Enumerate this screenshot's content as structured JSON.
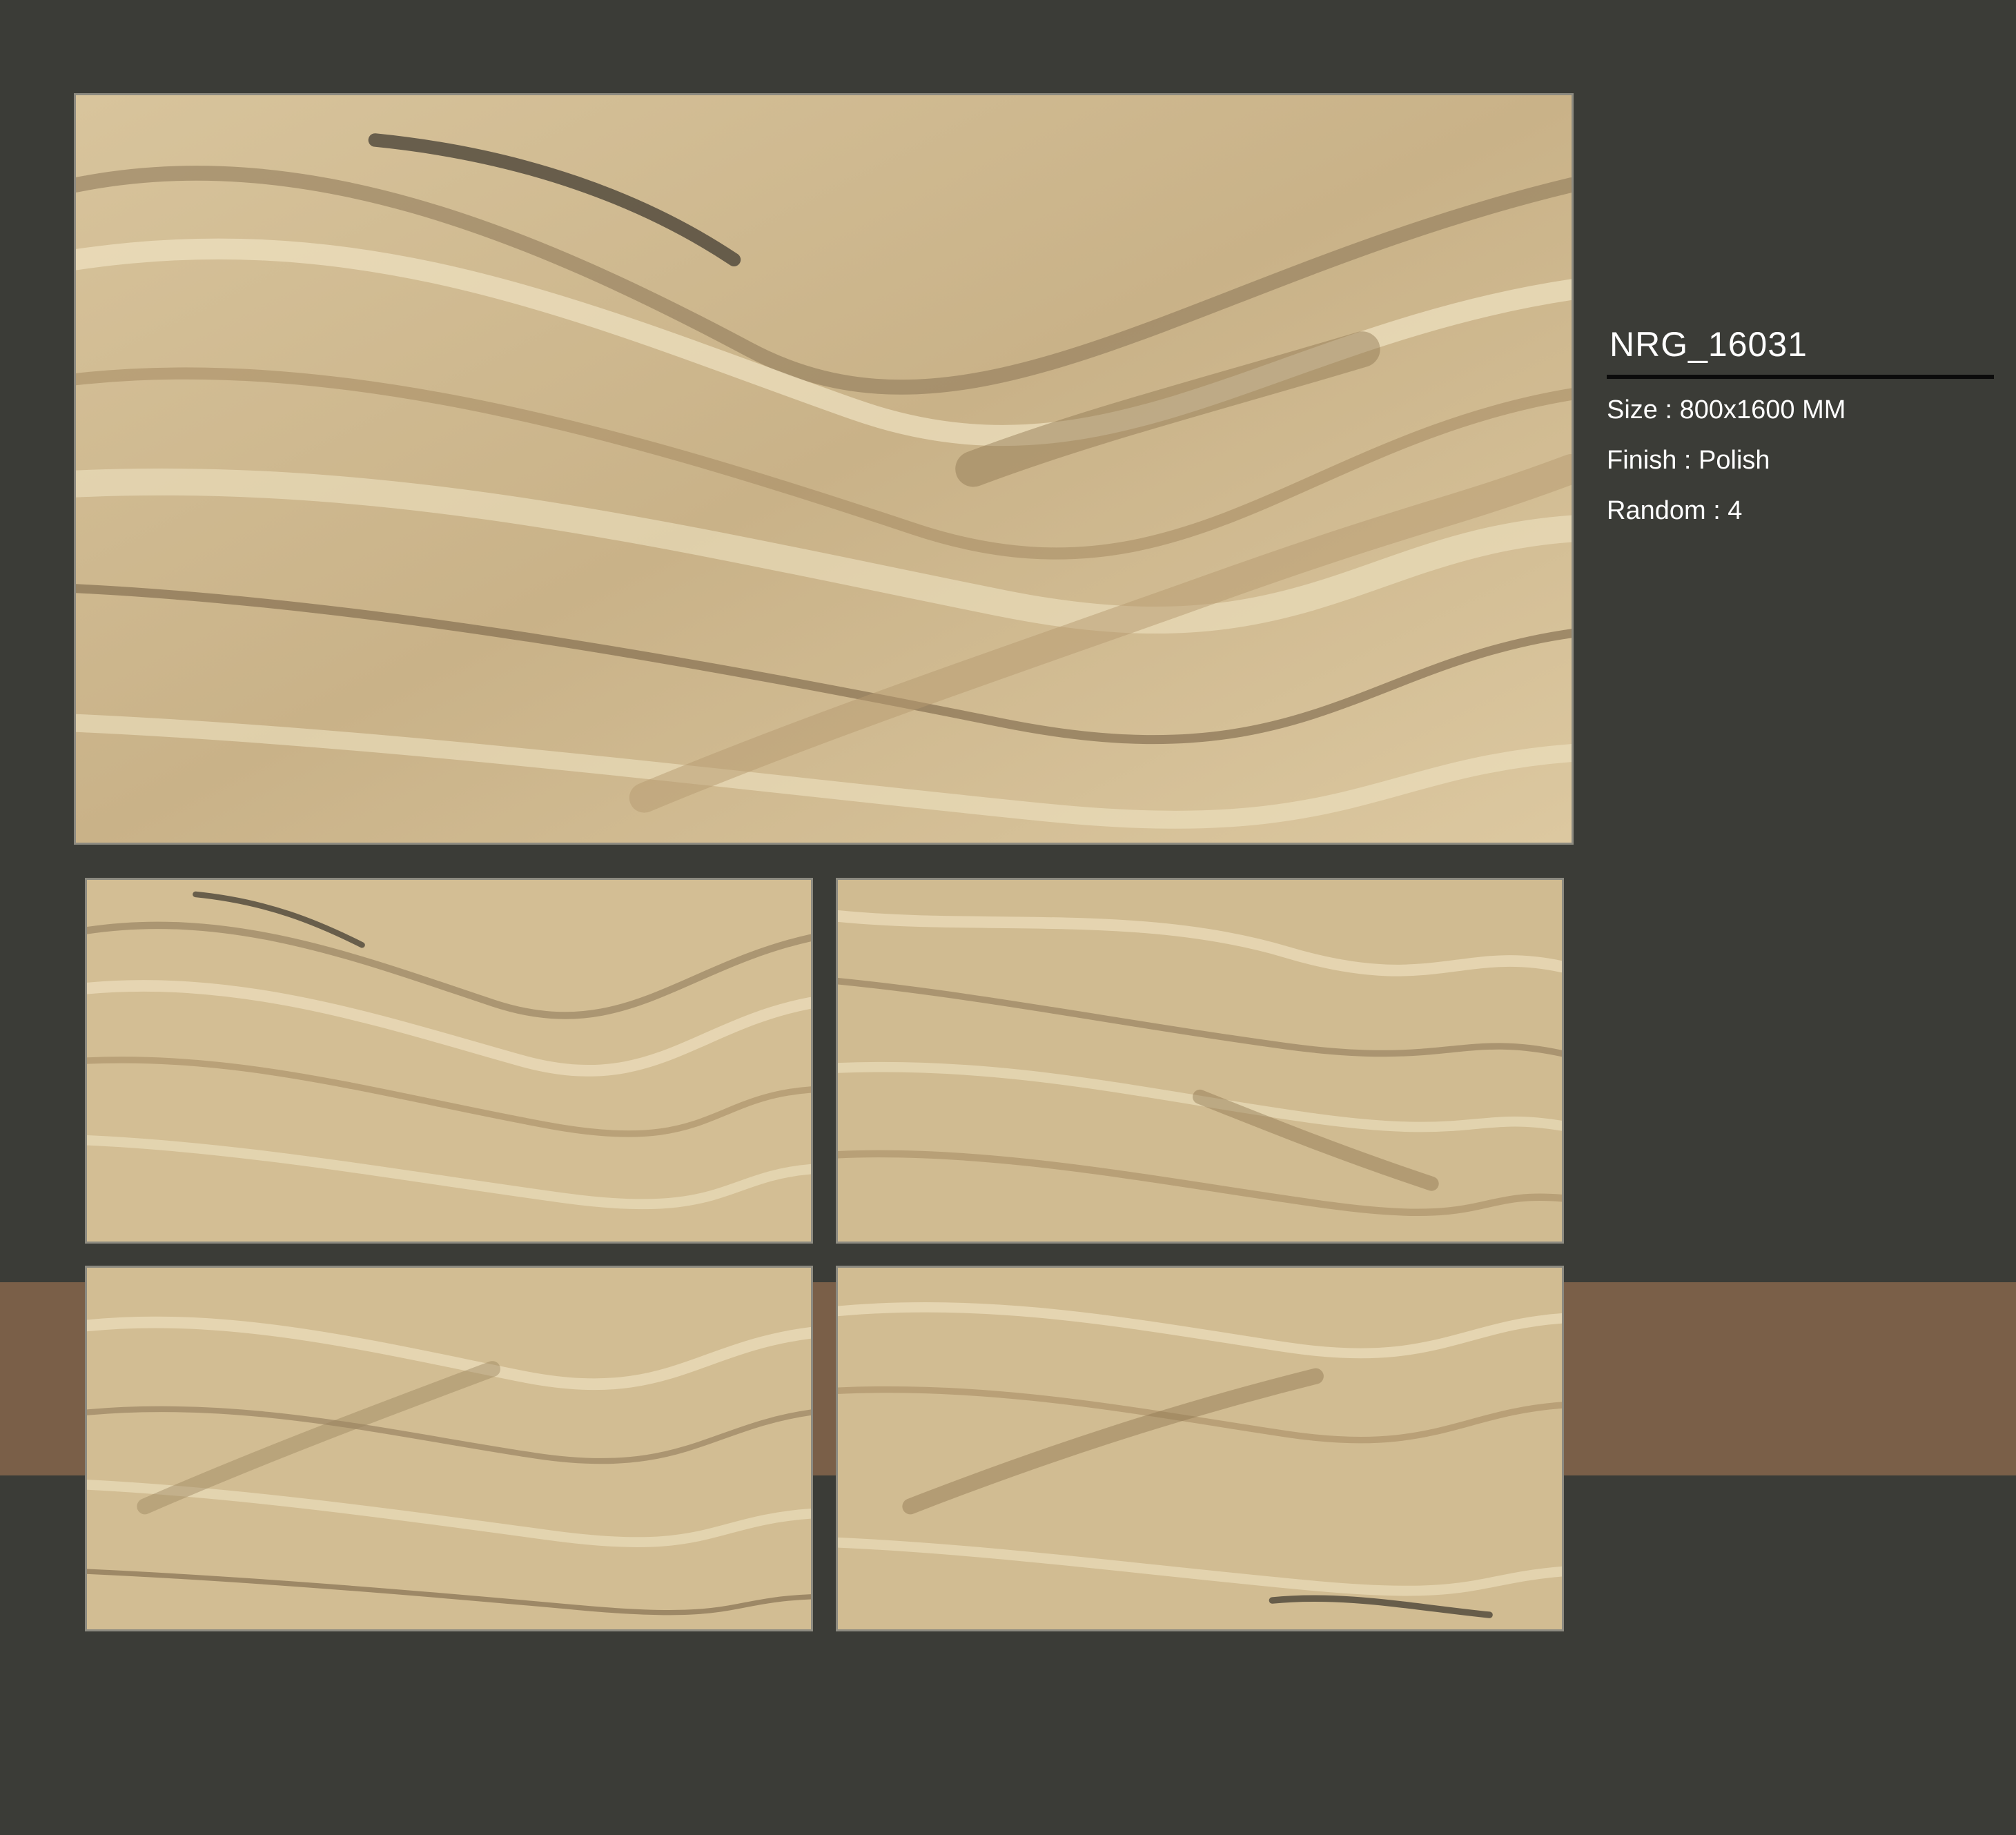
{
  "product": {
    "code": "NRG_16031",
    "size_line": "Size : 800x1600 MM",
    "finish_line": "Finish : Polish",
    "random_line": "Random : 4"
  },
  "colors": {
    "background": "#3b3c37",
    "accent_band": "#7a5f48",
    "marble_base": "#d2bd93",
    "vein_dark": "#8a7455",
    "vein_light": "#efe2c2"
  }
}
